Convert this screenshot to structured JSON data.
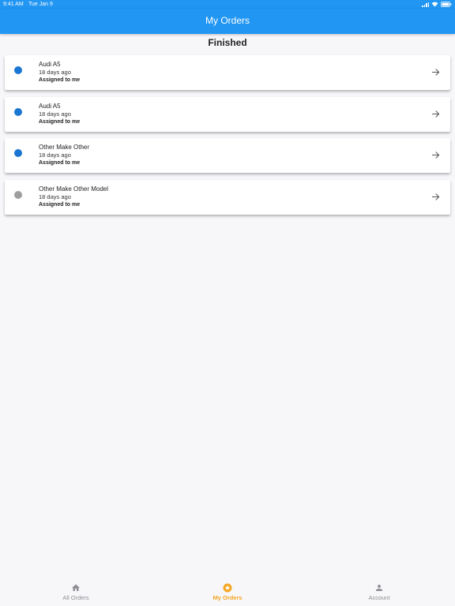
{
  "status_bar": {
    "time": "9:41 AM",
    "date": "Tue Jan 9"
  },
  "app_bar": {
    "title": "My Orders",
    "color": "#2196f3"
  },
  "section": {
    "title": "Finished"
  },
  "orders": [
    {
      "title": "Audi A5",
      "time": "18 days ago",
      "assignee": "Assigned to me",
      "dot_color": "#1976d2",
      "icon": "arrow-right-icon"
    },
    {
      "title": "Audi A5",
      "time": "18 days ago",
      "assignee": "Assigned to me",
      "dot_color": "#1976d2",
      "icon": "arrow-right-icon"
    },
    {
      "title": "Other Make Other",
      "time": "18 days ago",
      "assignee": "Assigned to me",
      "dot_color": "#1976d2",
      "icon": "arrow-right-icon"
    },
    {
      "title": "Other Make Other Model",
      "time": "18 days ago",
      "assignee": "Assigned to me",
      "dot_color": "#9e9e9e",
      "icon": "arrow-right-icon"
    }
  ],
  "bottom_nav": {
    "active_color": "#f5a623",
    "inactive_color": "#8e8e93",
    "items": [
      {
        "label": "All Orders",
        "icon": "home-icon",
        "active": false
      },
      {
        "label": "My Orders",
        "icon": "star-icon",
        "active": true
      },
      {
        "label": "Account",
        "icon": "person-icon",
        "active": false
      }
    ]
  }
}
